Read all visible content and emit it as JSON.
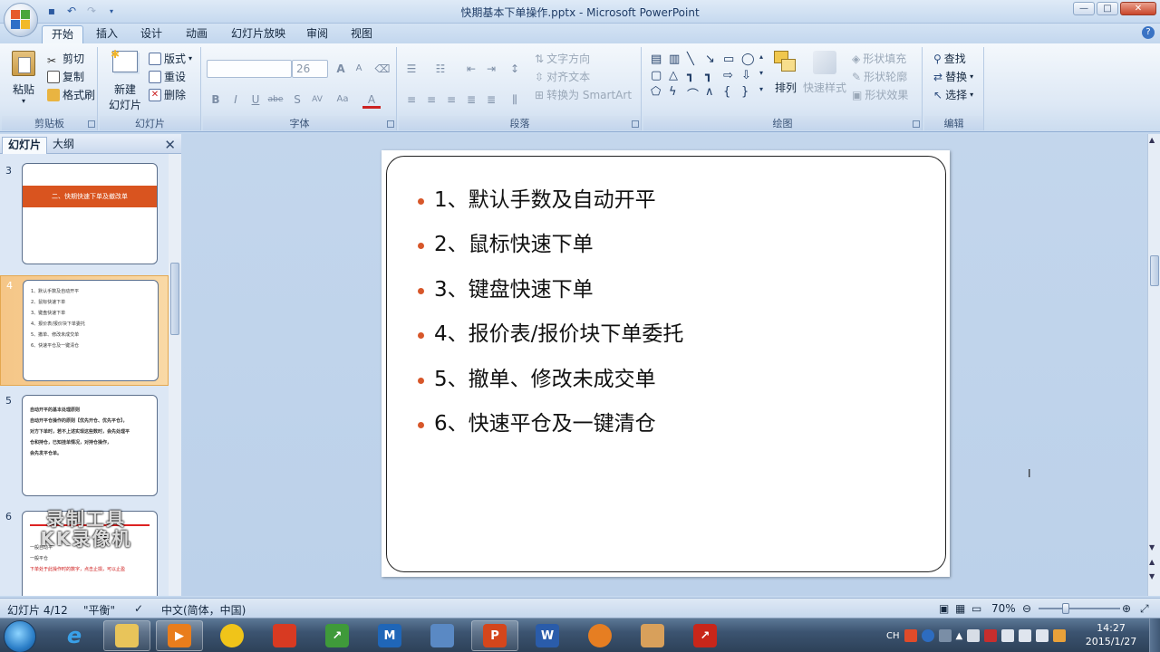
{
  "window": {
    "title": "快期基本下单操作.pptx - Microsoft PowerPoint",
    "minimize": "—",
    "maximize": "□",
    "close": "✕"
  },
  "ribbon_tabs": [
    "开始",
    "插入",
    "设计",
    "动画",
    "幻灯片放映",
    "审阅",
    "视图"
  ],
  "clipboard": {
    "paste": "粘贴",
    "cut": "剪切",
    "copy": "复制",
    "format_painter": "格式刷",
    "label": "剪贴板"
  },
  "slides_group": {
    "new_slide_1": "新建",
    "new_slide_2": "幻灯片",
    "layout": "版式",
    "reset": "重设",
    "delete": "删除",
    "label": "幻灯片"
  },
  "font_group": {
    "font_name": "",
    "font_size": "26",
    "grow": "A",
    "shrink": "A",
    "bold": "B",
    "italic": "I",
    "underline": "U",
    "strike": "abe",
    "shadow": "S",
    "spacing": "AV",
    "case": "Aa",
    "color": "A",
    "label": "字体"
  },
  "paragraph_group": {
    "text_direction": "文字方向",
    "align_text": "对齐文本",
    "smartart": "转换为 SmartArt",
    "label": "段落"
  },
  "drawing_group": {
    "arrange": "排列",
    "quick_styles": "快速样式",
    "shape_fill": "形状填充",
    "shape_outline": "形状轮廓",
    "shape_effects": "形状效果",
    "label": "绘图"
  },
  "editing_group": {
    "find": "查找",
    "replace": "替换",
    "select": "选择",
    "label": "编辑"
  },
  "left_panel": {
    "tab_slides": "幻灯片",
    "tab_outline": "大纲",
    "close": "✕",
    "thumbnails": [
      {
        "num": "3",
        "banner": "二、快期快速下单及撤改单"
      },
      {
        "num": "4",
        "lines": [
          "1、默认手数及自动开平",
          "2、鼠标快速下单",
          "3、键盘快速下单",
          "4、报价表/报价块下单委托",
          "5、撤单、修改未成交单",
          "6、快速平仓及一键清仓"
        ]
      },
      {
        "num": "5",
        "lines": [
          "自动开平的基本处理原则",
          "自动开平仓操作的原则【优先开仓、优先平仓】，",
          "对方下单时，若不上述实现这些数时，会先处理平",
          "仓和持仓，已知挂单情况，对持仓操作，",
          "会先发平仓单。"
        ]
      },
      {
        "num": "6",
        "lines": [
          "",
          "",
          "",
          "一般自动平",
          "一般平仓",
          "下单处于此操作时的数字，点击止损，可以止盈"
        ]
      }
    ]
  },
  "slide": {
    "bullets": [
      "1、默认手数及自动开平",
      "2、鼠标快速下单",
      "3、键盘快速下单",
      "4、报价表/报价块下单委托",
      "5、撤单、修改未成交单",
      "6、快速平仓及一键清仓"
    ]
  },
  "watermark": {
    "line1": "录制工具",
    "line2": "KK录像机"
  },
  "status_bar": {
    "slide_info": "幻灯片 4/12",
    "theme": "\"平衡\"",
    "language": "中文(简体，中国)",
    "zoom": "70%"
  },
  "taskbar": {
    "tray_lang": "CH",
    "time": "14:27",
    "date": "2015/1/27"
  },
  "colors": {
    "accent": "#d7572a",
    "ribbon_bg": "#dde8f5",
    "slide_area_bg": "#c3d6ec"
  }
}
